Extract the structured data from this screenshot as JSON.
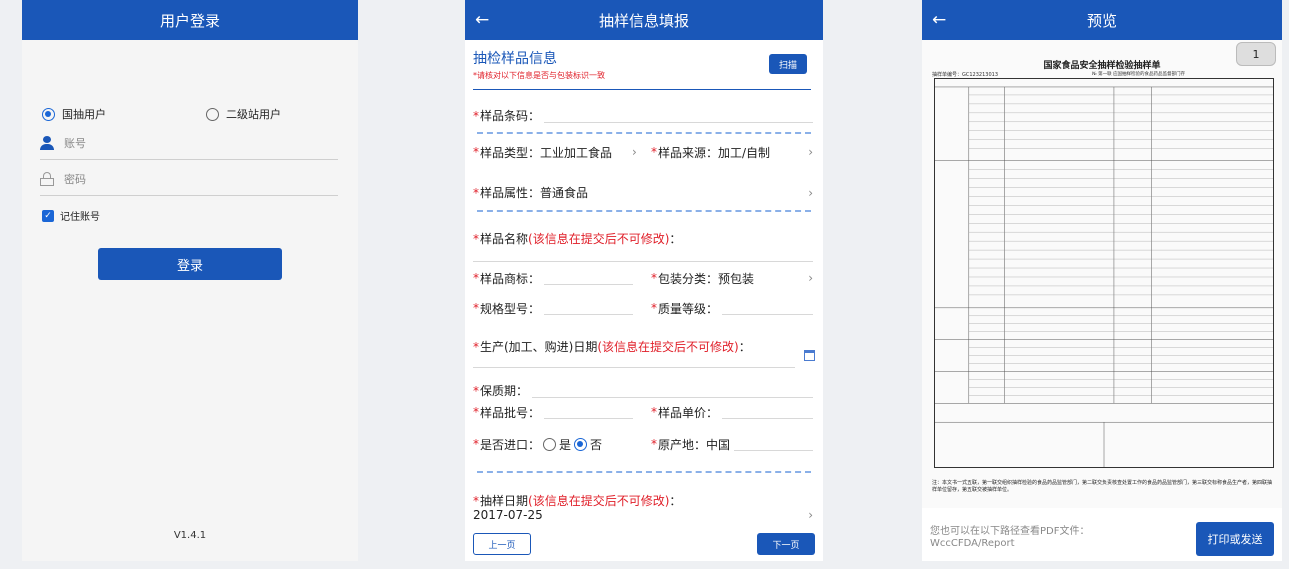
{
  "colors": {
    "primary": "#1a57b8",
    "required": "#e0202a",
    "background": "#eef0f3"
  },
  "login": {
    "title": "用户登录",
    "radio_a": "国抽用户",
    "radio_b": "二级站用户",
    "account_placeholder": "账号",
    "password_placeholder": "密码",
    "remember": "记住账号",
    "login_button": "登录",
    "version": "V1.4.1"
  },
  "form": {
    "title": "抽样信息填报",
    "section_title": "抽检样品信息",
    "section_note": "*请核对以下信息是否与包装标识一致",
    "scan_button": "扫描",
    "star": "*",
    "barcode_label": "样品条码：",
    "type_label": "样品类型：",
    "type_value": "工业加工食品",
    "source_label": "样品来源：",
    "source_value": "加工/自制",
    "attr_label": "样品属性：",
    "attr_value": "普通食品",
    "name_label": "样品名称",
    "name_note": "(该信息在提交后不可修改)",
    "name_colon": "：",
    "brand_label": "样品商标：",
    "pack_label": "包装分类：",
    "pack_value": "预包装",
    "spec_label": "规格型号：",
    "quality_label": "质量等级：",
    "date_label": "生产(加工、购进)日期",
    "date_note": "(该信息在提交后不可修改)",
    "date_colon": "：",
    "shelf_label": "保质期：",
    "batch_label": "样品批号：",
    "price_label": "样品单价：",
    "import_label": "是否进口：",
    "yes": "是",
    "no": "否",
    "origin_label": "原产地：",
    "origin_value": "中国",
    "sample_date_label": "抽样日期",
    "sample_date_note": "(该信息在提交后不可修改)",
    "sample_date_colon": "：",
    "sample_date_value": "2017-07-25",
    "prev_button": "上一页",
    "next_button": "下一页"
  },
  "preview": {
    "title": "预览",
    "page_number": "1",
    "doc_title": "国家食品安全抽样检验抽样单",
    "doc_no": "抽样单编号：GC123213013",
    "doc_no_right": "№  第一联 应国抽样检验的食品药品监督部门存",
    "doc_footer": "注：本文书一式五联，第一联交组织抽样检验的食品药品监管部门，第二联交负责核查处置工作的食品药品监管部门，第三联交标称食品生产者，第四联抽样单位留存，第五联交被抽样单位。",
    "tip_line1": "您也可以在以下路径查看PDF文件：",
    "tip_line2": "WccCFDA/Report",
    "print_button": "打印或发送"
  }
}
